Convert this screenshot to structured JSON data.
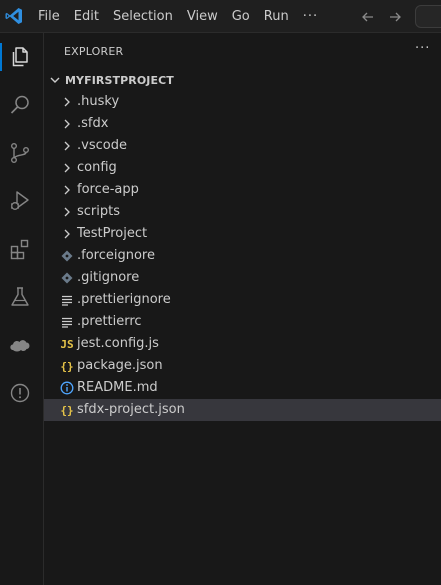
{
  "menu": {
    "items": [
      "File",
      "Edit",
      "Selection",
      "View",
      "Go",
      "Run"
    ],
    "more": "···"
  },
  "colors": {
    "accent": "#0078d4",
    "json_icon": "#e6c449",
    "js_icon": "#e6c449",
    "info_icon": "#4fa6ff",
    "git_icon": "#6a7a8a"
  },
  "activity_bar": {
    "icons": [
      "files-icon",
      "search-icon",
      "source-control-icon",
      "run-debug-icon",
      "extensions-icon",
      "testing-icon",
      "salesforce-icon",
      "problems-icon"
    ]
  },
  "explorer": {
    "header": "EXPLORER",
    "more": "···",
    "project": "MYFIRSTPROJECT",
    "items": [
      {
        "label": ".husky",
        "kind": "folder",
        "icon": "chevron-right-icon"
      },
      {
        "label": ".sfdx",
        "kind": "folder",
        "icon": "chevron-right-icon"
      },
      {
        "label": ".vscode",
        "kind": "folder",
        "icon": "chevron-right-icon"
      },
      {
        "label": "config",
        "kind": "folder",
        "icon": "chevron-right-icon"
      },
      {
        "label": "force-app",
        "kind": "folder",
        "icon": "chevron-right-icon"
      },
      {
        "label": "scripts",
        "kind": "folder",
        "icon": "chevron-right-icon"
      },
      {
        "label": "TestProject",
        "kind": "folder",
        "icon": "chevron-right-icon"
      },
      {
        "label": ".forceignore",
        "kind": "file",
        "icon": "git-file-icon"
      },
      {
        "label": ".gitignore",
        "kind": "file",
        "icon": "git-file-icon"
      },
      {
        "label": ".prettierignore",
        "kind": "file",
        "icon": "lines-file-icon"
      },
      {
        "label": ".prettierrc",
        "kind": "file",
        "icon": "lines-file-icon"
      },
      {
        "label": "jest.config.js",
        "kind": "file",
        "icon": "js-file-icon",
        "glyph": "JS"
      },
      {
        "label": "package.json",
        "kind": "file",
        "icon": "json-file-icon",
        "glyph": "{}"
      },
      {
        "label": "README.md",
        "kind": "file",
        "icon": "info-file-icon"
      },
      {
        "label": "sfdx-project.json",
        "kind": "file",
        "icon": "json-file-icon",
        "glyph": "{}",
        "selected": true
      }
    ]
  }
}
